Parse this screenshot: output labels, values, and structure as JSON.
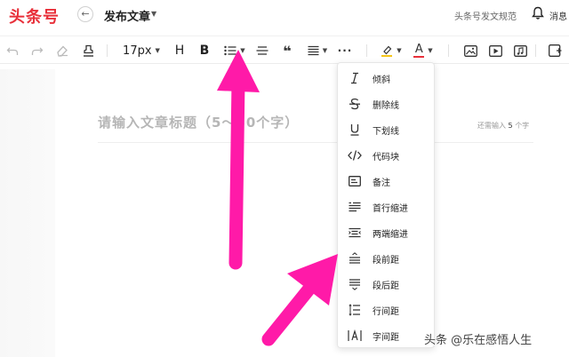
{
  "header": {
    "logo": "头条号",
    "back_icon": "arrow-left-icon",
    "page_title": "发布文章",
    "spec_link": "头条号发文规范",
    "bell_icon": "bell-icon",
    "messages_label": "消息"
  },
  "toolbar": {
    "undo_icon": "undo-icon",
    "redo_icon": "redo-icon",
    "eraser_icon": "eraser-icon",
    "format_painter_icon": "format-painter-icon",
    "font_size": "17px",
    "heading_label": "H",
    "bold_label": "B",
    "list_icon": "unordered-list-icon",
    "divider_icon": "divider-icon",
    "quote_label": "❝",
    "align_icon": "align-icon",
    "more_label": "···",
    "highlight_icon": "highlight-icon",
    "text_color_label": "A",
    "text_color": "#e8303a",
    "image_icon": "image-icon",
    "video_icon": "video-icon",
    "insert_icon": "insert-icon"
  },
  "editor": {
    "title_placeholder": "请输入文章标题（5～30个字）",
    "remaining_prefix": "还需输入",
    "remaining_count": "5",
    "remaining_suffix": "个字"
  },
  "more_menu": {
    "items": [
      {
        "label": "倾斜",
        "icon": "italic-icon"
      },
      {
        "label": "删除线",
        "icon": "strikethrough-icon"
      },
      {
        "label": "下划线",
        "icon": "underline-icon"
      },
      {
        "label": "代码块",
        "icon": "code-block-icon"
      },
      {
        "label": "备注",
        "icon": "note-icon"
      },
      {
        "label": "首行缩进",
        "icon": "first-line-indent-icon"
      },
      {
        "label": "两端缩进",
        "icon": "both-side-indent-icon"
      },
      {
        "label": "段前距",
        "icon": "space-before-paragraph-icon"
      },
      {
        "label": "段后距",
        "icon": "space-after-paragraph-icon"
      },
      {
        "label": "行间距",
        "icon": "line-spacing-icon"
      },
      {
        "label": "字间距",
        "icon": "letter-spacing-icon"
      }
    ]
  },
  "annotations": {
    "arrow_color": "#ff1aa8"
  },
  "watermark": "头条 @乐在感悟人生"
}
